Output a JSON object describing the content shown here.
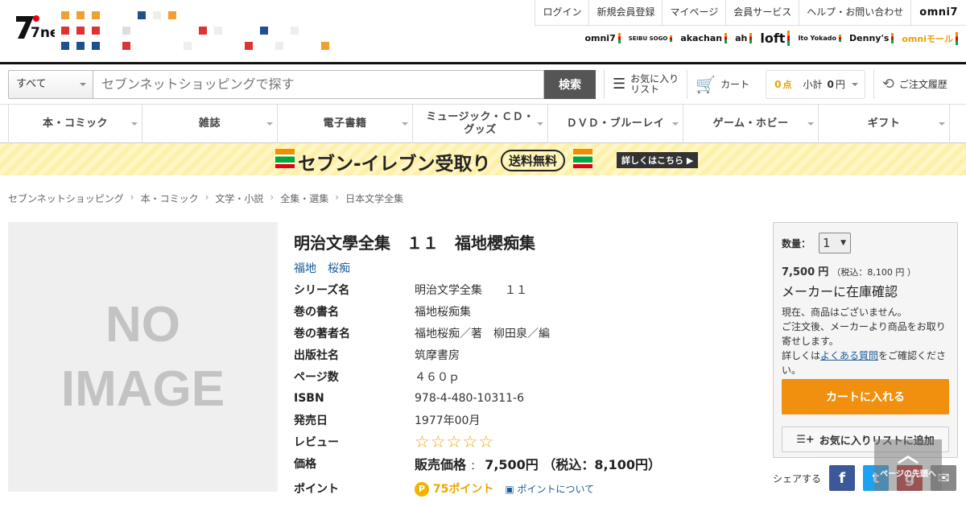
{
  "header": {
    "logo": "7net",
    "toplinks": [
      "ログイン",
      "新規会員登録",
      "マイページ",
      "会員サービス",
      "ヘルプ・お問い合わせ"
    ],
    "omni7": "omni7",
    "brands": [
      "omni7",
      "SEIBU SOGO",
      "akachan",
      "ah",
      "loft",
      "Ito Yokado",
      "Denny's",
      "omniモール"
    ]
  },
  "search": {
    "category": "すべて",
    "placeholder": "セブンネットショッピングで探す",
    "button": "検索",
    "favorites": "お気に入り\nリスト",
    "cart": "カート",
    "points_value": "0",
    "points_unit": "点",
    "subtotal_label": "小計",
    "subtotal_value": "0",
    "subtotal_unit": "円",
    "history": "ご注文履歴"
  },
  "nav": [
    "本・コミック",
    "雑誌",
    "電子書籍",
    "ミュージック・ＣＤ・グッズ",
    "ＤＶＤ・ブルーレイ",
    "ゲーム・ホビー",
    "ギフト"
  ],
  "banner": {
    "title": "セブン-イレブン受取り",
    "free": "送料無料",
    "more": "詳しくはこちら"
  },
  "breadcrumb": [
    "セブンネットショッピング",
    "本・コミック",
    "文学・小説",
    "全集・選集",
    "日本文学全集"
  ],
  "image": {
    "line1": "NO",
    "line2": "IMAGE"
  },
  "product": {
    "title": "明治文學全集　１１　福地櫻痴集",
    "author": "福地　桜痴",
    "specs": [
      {
        "k": "シリーズ名",
        "v": "明治文学全集　　１１"
      },
      {
        "k": "巻の書名",
        "v": "福地桜痴集"
      },
      {
        "k": "巻の著者名",
        "v": "福地桜痴／著　柳田泉／編"
      },
      {
        "k": "出版社名",
        "v": "筑摩書房"
      },
      {
        "k": "ページ数",
        "v": "４６０ｐ"
      },
      {
        "k": "ISBN",
        "v": "978-4-480-10311-6"
      },
      {
        "k": "発売日",
        "v": "1977年00月"
      }
    ],
    "review_label": "レビュー",
    "rating": 0,
    "price_label": "価格",
    "price_text": "販売価格",
    "price_sep": "：",
    "price_value": "7,500円",
    "price_tax": "（税込：8,100円）",
    "point_label": "ポイント",
    "points": "75ポイント",
    "points_about": "ポイントについて"
  },
  "buybox": {
    "qty_label": "数量：",
    "qty": "1",
    "price": "7,500",
    "price_unit": "円",
    "price_tax": "（税込：8,100 円 ）",
    "stock": "メーカーに在庫確認",
    "note1": "現在、商品はございません。",
    "note2": "ご注文後、メーカーより商品をお取り寄せします。",
    "note3_pre": "詳しくは",
    "note3_link": "よくある質問",
    "note3_post": "をご確認ください。",
    "cart_button": "カートに入れる",
    "fav_button": "お気に入りリストに追加"
  },
  "share": {
    "label": "シェアする",
    "totop": "ページの先頭へ"
  },
  "colors": {
    "accent": "#f0900e",
    "link": "#1a5b9a",
    "star": "#f0a500"
  }
}
